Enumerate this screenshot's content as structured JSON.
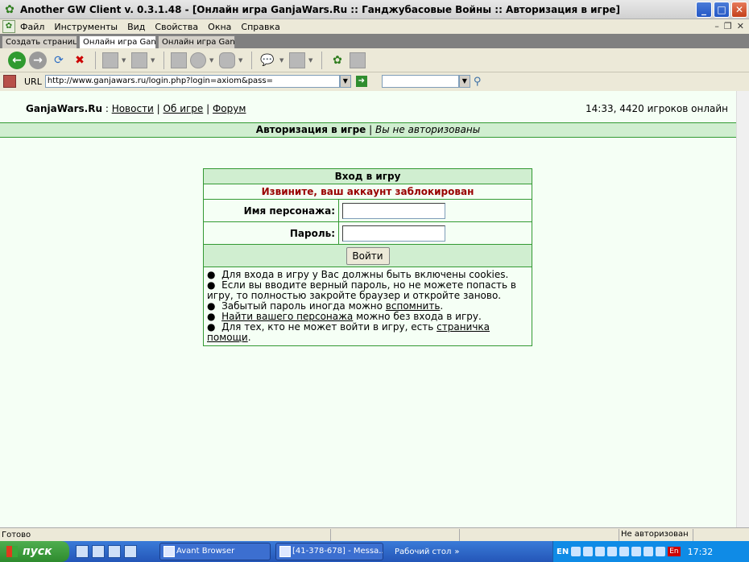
{
  "window": {
    "title": "Another GW Client v. 0.3.1.48 - [Онлайн игра GanjaWars.Ru :: Ганджубасовые Войны :: Авторизация в игре]"
  },
  "menu": [
    "Файл",
    "Инструменты",
    "Вид",
    "Свойства",
    "Окна",
    "Справка"
  ],
  "tabs": [
    "Создать страницу",
    "Онлайн игра GanjaW",
    "Онлайн игра GanjaW"
  ],
  "address": {
    "label": "URL",
    "url": "http://www.ganjawars.ru/login.php?login=axiom&pass="
  },
  "page": {
    "brand": "GanjaWars.Ru",
    "brand_sep": " : ",
    "nav": [
      "Новости",
      "Об игре",
      "Форум"
    ],
    "online": "14:33, 4420 игроков онлайн",
    "auth_title": "Авторизация в игре",
    "auth_sep": " | ",
    "auth_status": "Вы не авторизованы",
    "login": {
      "header": "Вход в игру",
      "error": "Извините, ваш аккаунт заблокирован",
      "username_label": "Имя персонажа:",
      "password_label": "Пароль:",
      "submit": "Войти"
    },
    "notes": {
      "n1": "Для входа в игру у Вас должны быть включены cookies.",
      "n2": "Если вы вводите верный пароль, но не можете попасть в игру, то полностью закройте браузер и откройте заново.",
      "n3_pre": "Забытый пароль иногда можно ",
      "n3_link": "вспомнить",
      "n3_post": ".",
      "n4_link": "Найти вашего персонажа",
      "n4_post": " можно без входа в игру.",
      "n5_pre": "Для тех, кто не может войти в игру, есть ",
      "n5_link": "страничка помощи",
      "n5_post": "."
    }
  },
  "status": {
    "left": "Готово",
    "right": "Не авторизован"
  },
  "taskbar": {
    "start": "пуск",
    "tasks": [
      "Avant Browser",
      "[41-378-678] - Messa..."
    ],
    "desktop": "Рабочий стол",
    "lang": "EN",
    "lang_badge": "En",
    "clock": "17:32"
  }
}
